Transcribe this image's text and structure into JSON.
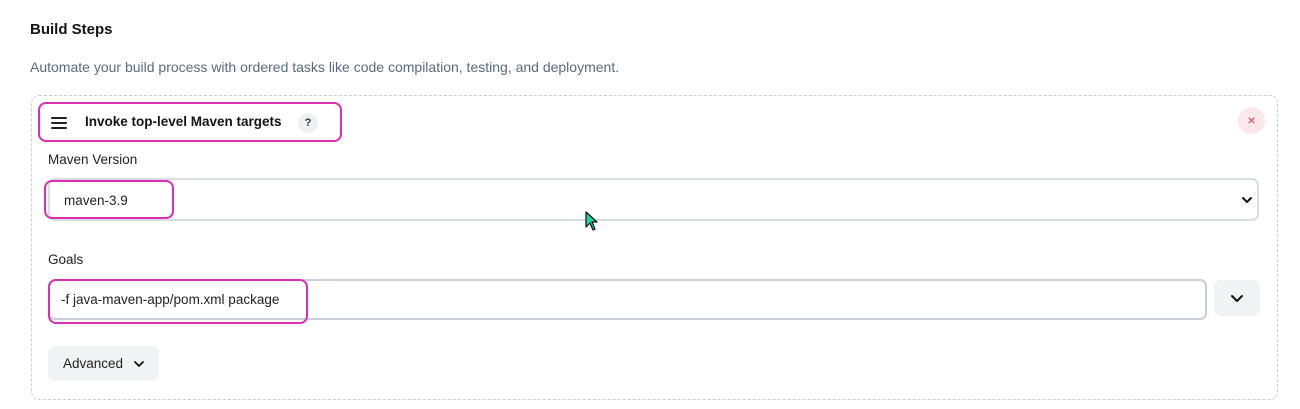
{
  "section": {
    "title": "Build Steps",
    "description": "Automate your build process with ordered tasks like code compilation, testing, and deployment."
  },
  "step": {
    "title": "Invoke top-level Maven targets",
    "help_label": "?",
    "close_label": "×",
    "maven_version": {
      "label": "Maven Version",
      "selected": "maven-3.9"
    },
    "goals": {
      "label": "Goals",
      "value": "-f java-maven-app/pom.xml package"
    },
    "advanced_label": "Advanced"
  },
  "colors": {
    "highlight": "#d92fb0",
    "close_bg": "#fde7ea",
    "close_fg": "#e0344f",
    "description": "#5b6b7e"
  },
  "icons": [
    "drag-handle-icon",
    "help-icon",
    "close-icon",
    "chevron-down-icon",
    "mouse-cursor-icon"
  ]
}
